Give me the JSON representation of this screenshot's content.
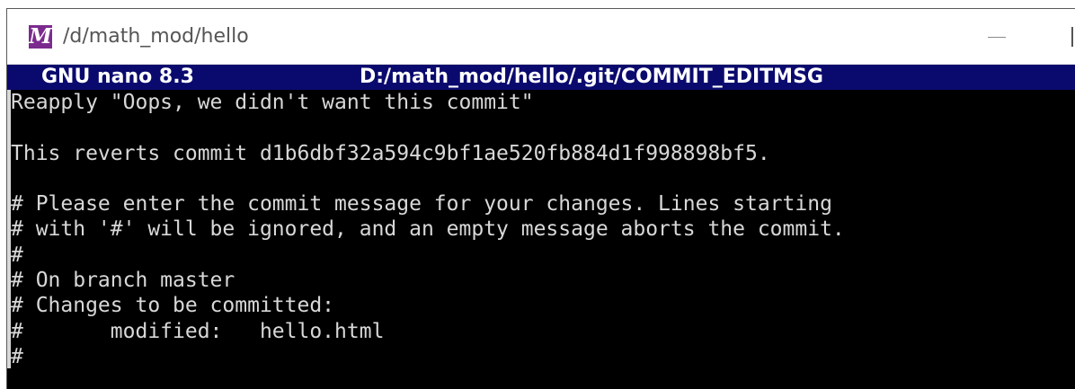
{
  "window": {
    "title": "/d/math_mod/hello",
    "icon": "mintty-m-icon",
    "icon_letter": "M",
    "icon_color": "#7b2b8e"
  },
  "nano": {
    "version": "GNU nano 8.3",
    "filename": "D:/math_mod/hello/.git/COMMIT_EDITMSG",
    "header_bg": "#0a0a6e"
  },
  "editor": {
    "lines": [
      "Reapply \"Oops, we didn't want this commit\"",
      "",
      "This reverts commit d1b6dbf32a594c9bf1ae520fb884d1f998898bf5.",
      "",
      "# Please enter the commit message for your changes. Lines starting",
      "# with '#' will be ignored, and an empty message aborts the commit.",
      "#",
      "# On branch master",
      "# Changes to be committed:",
      "#       modified:   hello.html",
      "#"
    ]
  }
}
